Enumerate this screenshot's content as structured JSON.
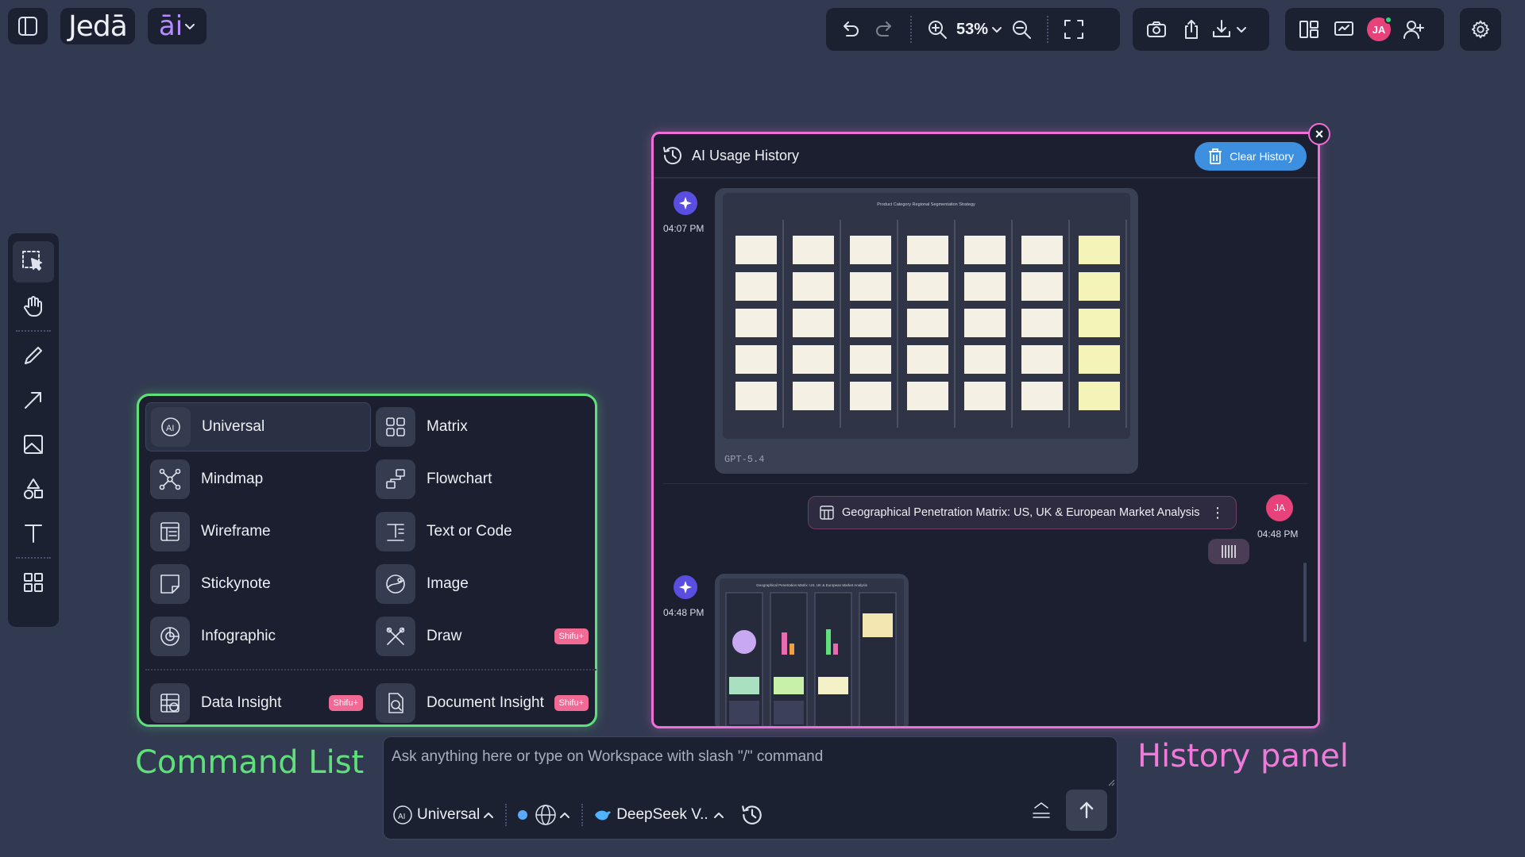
{
  "brand": {
    "name": "Jedā",
    "ai_label": "āi"
  },
  "zoom": "53%",
  "user_initials": "JA",
  "command_list": {
    "items": [
      {
        "label": "Universal",
        "badge": ""
      },
      {
        "label": "Matrix",
        "badge": ""
      },
      {
        "label": "Mindmap",
        "badge": ""
      },
      {
        "label": "Flowchart",
        "badge": ""
      },
      {
        "label": "Wireframe",
        "badge": ""
      },
      {
        "label": "Text or Code",
        "badge": ""
      },
      {
        "label": "Stickynote",
        "badge": ""
      },
      {
        "label": "Image",
        "badge": ""
      },
      {
        "label": "Infographic",
        "badge": ""
      },
      {
        "label": "Draw",
        "badge": "Shifu+"
      },
      {
        "label": "Data Insight",
        "badge": "Shifu+"
      },
      {
        "label": "Document Insight",
        "badge": "Shifu+"
      }
    ],
    "annotation": "Command List"
  },
  "history": {
    "title": "AI Usage History",
    "clear_label": "Clear History",
    "annotation": "History panel",
    "entries": [
      {
        "time": "04:07 PM",
        "model": "GPT-5.4",
        "thumb_title": "Product Category Regional Segmentation Strategy"
      },
      {
        "time": "04:48 PM",
        "prompt": "Geographical Penetration Matrix: US, UK & European Market Analysis",
        "user": "JA"
      },
      {
        "time": "04:48 PM",
        "thumb_title": "Geographical Penetration Matrix: US, UK & European Market Analysis"
      }
    ]
  },
  "chat": {
    "placeholder": "Ask anything here or type on Workspace with slash \"/\" command",
    "mode": "Universal",
    "model": "DeepSeek V.."
  },
  "colors": {
    "command_border": "#5fe07a",
    "history_border": "#ee6fd6",
    "clear_button": "#3d8fe0",
    "badge": "#f06a94"
  }
}
